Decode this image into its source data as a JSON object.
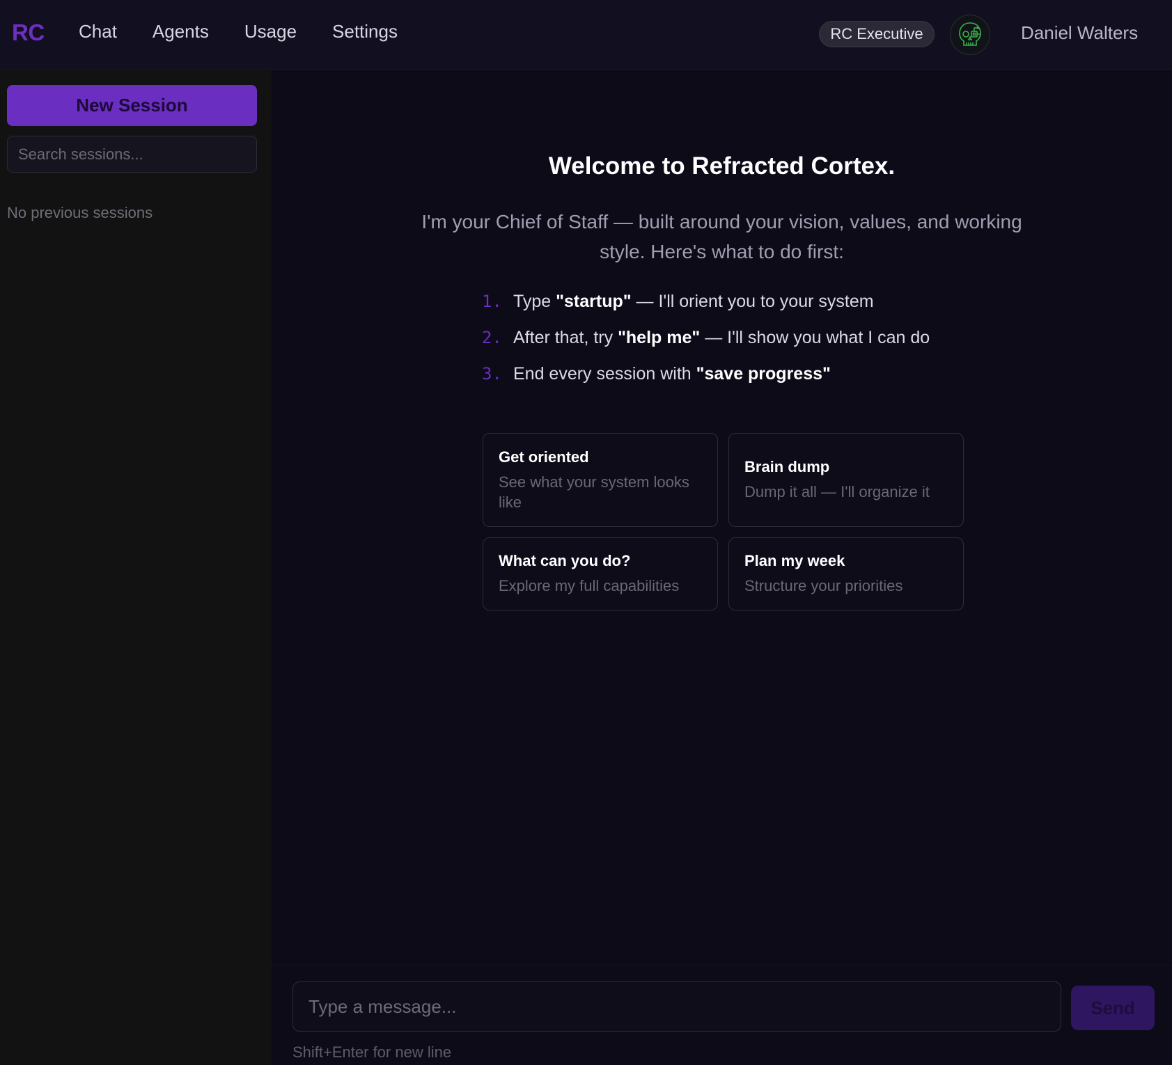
{
  "header": {
    "logo": "RC",
    "nav": [
      "Chat",
      "Agents",
      "Usage",
      "Settings"
    ],
    "plan_badge": "RC Executive",
    "avatar_icon": "skull-circuit-icon",
    "username": "Daniel Walters"
  },
  "sidebar": {
    "new_session_label": "New Session",
    "search_placeholder": "Search sessions...",
    "empty_text": "No previous sessions"
  },
  "main": {
    "title": "Welcome to Refracted Cortex.",
    "subtitle": "I'm your Chief of Staff — built around your vision, values, and working style. Here's what to do first:",
    "steps": [
      {
        "num": "1.",
        "pre": "Type ",
        "bold": "\"startup\"",
        "post": " — I'll orient you to your system"
      },
      {
        "num": "2.",
        "pre": "After that, try ",
        "bold": "\"help me\"",
        "post": " — I'll show you what I can do"
      },
      {
        "num": "3.",
        "pre": "End every session with ",
        "bold": "\"save progress\"",
        "post": ""
      }
    ],
    "cards": [
      {
        "title": "Get oriented",
        "desc": "See what your system looks like"
      },
      {
        "title": "Brain dump",
        "desc": "Dump it all — I'll organize it"
      },
      {
        "title": "What can you do?",
        "desc": "Explore my full capabilities"
      },
      {
        "title": "Plan my week",
        "desc": "Structure your priorities"
      }
    ]
  },
  "composer": {
    "placeholder": "Type a message...",
    "send_label": "Send",
    "hint": "Shift+Enter for new line"
  },
  "colors": {
    "accent": "#6a2ec0",
    "background": "#0d0b18",
    "sidebar": "#121212"
  }
}
